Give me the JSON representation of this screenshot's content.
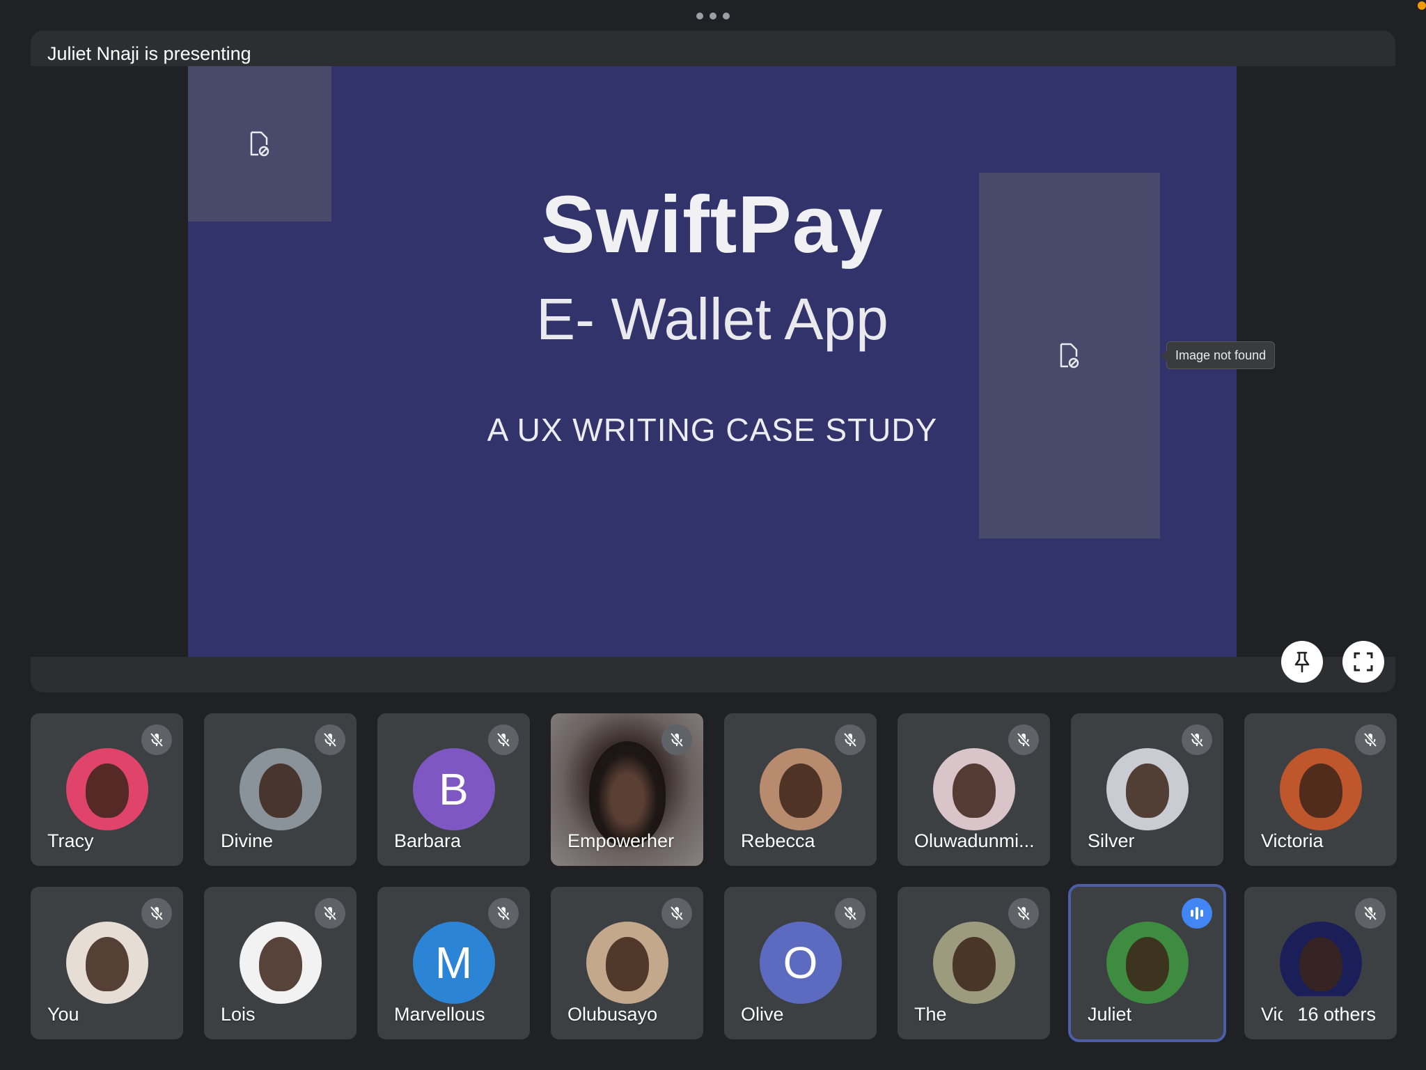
{
  "presentation": {
    "presenter_label": "Juliet Nnaji is presenting",
    "slide": {
      "title": "SwiftPay",
      "subtitle": "E- Wallet App",
      "tagline": "A UX WRITING CASE STUDY",
      "background_color": "#31336a"
    },
    "tooltip": "Image not found"
  },
  "controls": {
    "pin_icon": "pin-icon",
    "fullscreen_icon": "fullscreen-icon",
    "more_icon": "more-horizontal-icon"
  },
  "participants": [
    {
      "name": "Tracy",
      "avatar_type": "photo",
      "avatar_color": "#e0446a",
      "mic": "muted"
    },
    {
      "name": "Divine",
      "avatar_type": "photo",
      "avatar_color": "#8a9399",
      "mic": "muted"
    },
    {
      "name": "Barbara",
      "avatar_type": "letter",
      "letter": "B",
      "avatar_color": "#7e57c2",
      "mic": "muted"
    },
    {
      "name": "Empowerher",
      "avatar_type": "video",
      "mic": "muted"
    },
    {
      "name": "Rebecca",
      "avatar_type": "photo",
      "avatar_color": "#b88a6e",
      "mic": "muted"
    },
    {
      "name": "Oluwadunmi...",
      "avatar_type": "photo",
      "avatar_color": "#d9c4c9",
      "mic": "muted"
    },
    {
      "name": "Silver",
      "avatar_type": "photo",
      "avatar_color": "#c9ccd2",
      "mic": "muted"
    },
    {
      "name": "Victoria",
      "avatar_type": "photo",
      "avatar_color": "#c0562c",
      "mic": "muted"
    },
    {
      "name": "You",
      "avatar_type": "photo",
      "avatar_color": "#e6ddd4",
      "mic": "muted"
    },
    {
      "name": "Lois",
      "avatar_type": "photo",
      "avatar_color": "#f2f2f2",
      "mic": "muted"
    },
    {
      "name": "Marvellous",
      "avatar_type": "letter",
      "letter": "M",
      "avatar_color": "#2b84d6",
      "mic": "muted"
    },
    {
      "name": "Olubusayo",
      "avatar_type": "photo",
      "avatar_color": "#c4a88c",
      "mic": "muted"
    },
    {
      "name": "Olive",
      "avatar_type": "letter",
      "letter": "O",
      "avatar_color": "#5c6bc0",
      "mic": "muted"
    },
    {
      "name": "The",
      "avatar_type": "photo",
      "avatar_color": "#9c9b7e",
      "mic": "muted"
    },
    {
      "name": "Juliet",
      "avatar_type": "photo",
      "avatar_color": "#3d8c3f",
      "mic": "speaking"
    },
    {
      "name": "Vic",
      "avatar_type": "photo",
      "avatar_color": "#1a1f5a",
      "mic": "muted"
    }
  ],
  "others_pill": "16 others",
  "colors": {
    "background": "#202124",
    "tile": "#3c4043",
    "speaking_accent": "#4285f4",
    "muted_badge": "#5f6368"
  }
}
